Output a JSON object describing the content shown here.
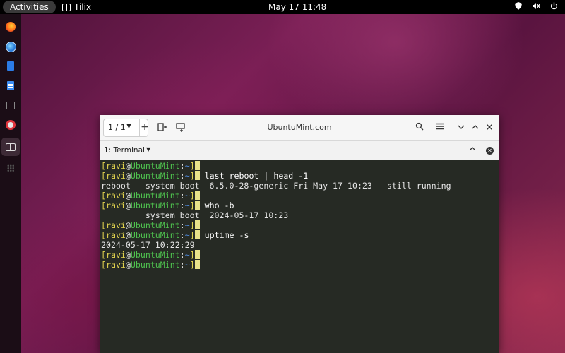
{
  "topbar": {
    "activities": "Activities",
    "app_name": "Tilix",
    "clock": "May 17  11:48"
  },
  "dock": {
    "items": [
      "firefox-icon",
      "thunderbird-icon",
      "text-editor-icon",
      "writer-icon",
      "reader-icon",
      "help-icon",
      "tilix-icon",
      "app-grid-icon"
    ]
  },
  "window": {
    "session_indicator": "1 / 1",
    "title": "UbuntuMint.com",
    "tab_label": "1: Terminal"
  },
  "prompt": {
    "user": "ravi",
    "host": "UbuntuMint",
    "dir": "~"
  },
  "terminal": {
    "lines": [
      {
        "type": "prompt",
        "cmd": ""
      },
      {
        "type": "prompt",
        "cmd": "last reboot | head -1"
      },
      {
        "type": "output",
        "text": "reboot   system boot  6.5.0-28-generic Fri May 17 10:23   still running"
      },
      {
        "type": "prompt",
        "cmd": ""
      },
      {
        "type": "prompt",
        "cmd": "who -b"
      },
      {
        "type": "output",
        "text": "         system boot  2024-05-17 10:23"
      },
      {
        "type": "prompt",
        "cmd": ""
      },
      {
        "type": "prompt",
        "cmd": "uptime -s"
      },
      {
        "type": "output",
        "text": "2024-05-17 10:22:29"
      },
      {
        "type": "prompt",
        "cmd": ""
      },
      {
        "type": "prompt",
        "cmd": ""
      }
    ]
  },
  "colors": {
    "terminal_bg": "#262a24",
    "prompt_user": "#dfd24f",
    "prompt_host": "#4ec24e",
    "prompt_dir": "#4f8be0"
  }
}
